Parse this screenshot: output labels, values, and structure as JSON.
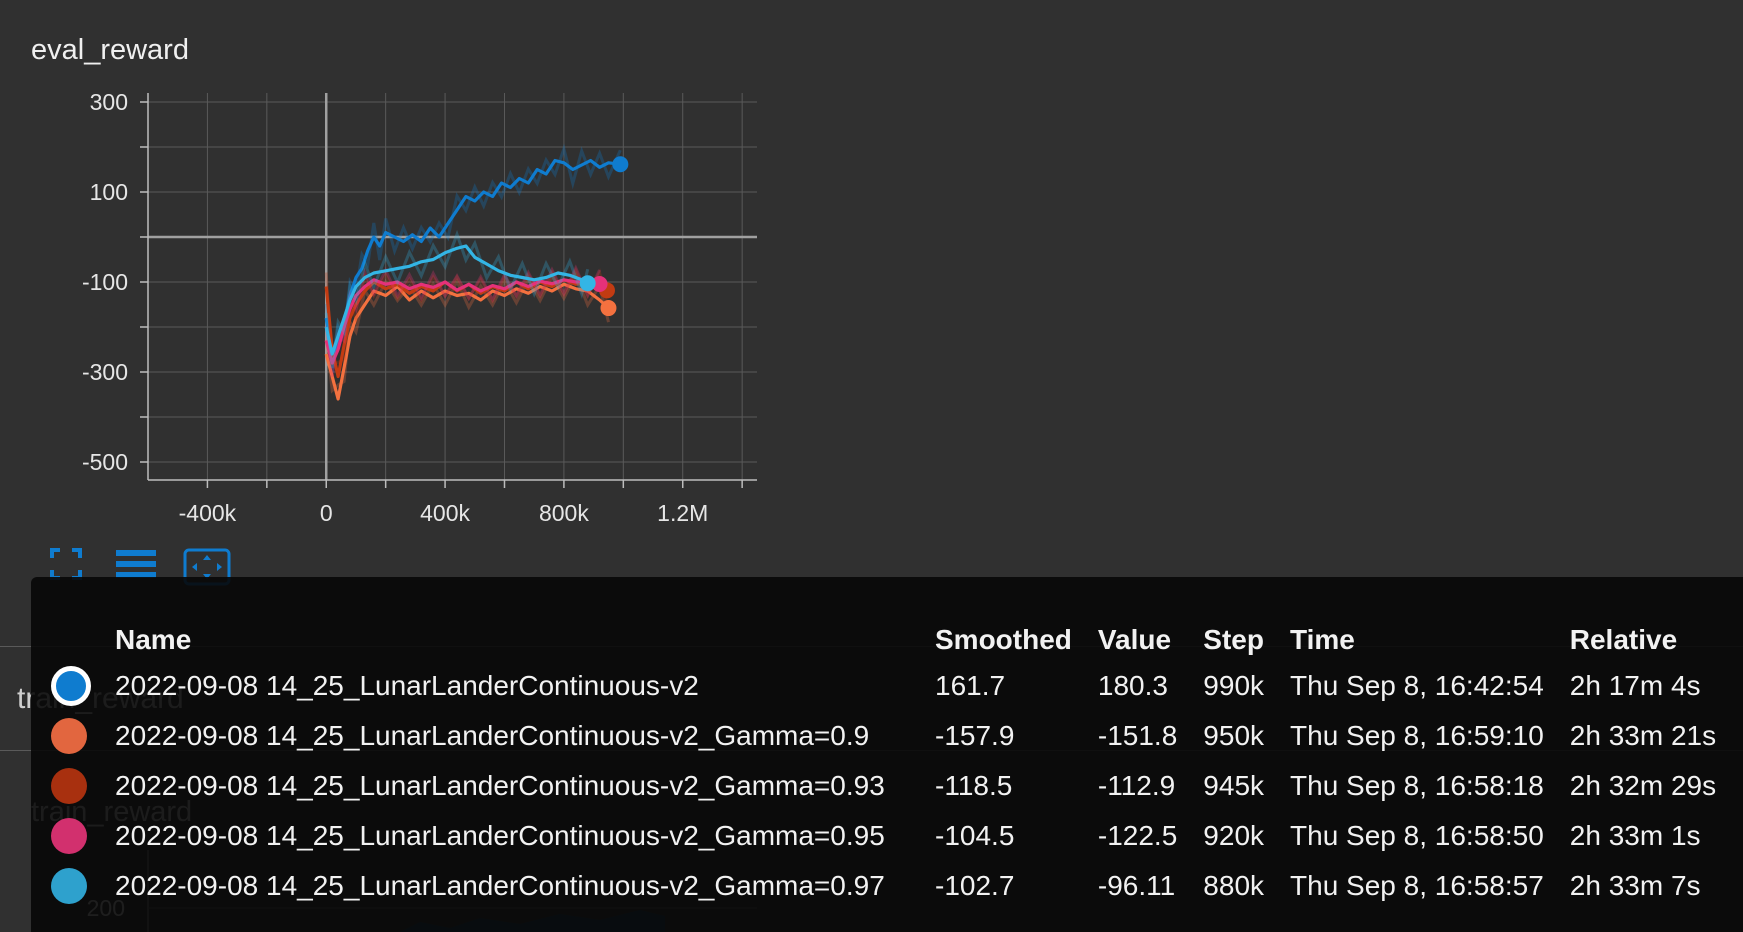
{
  "card": {
    "title": "eval_reward"
  },
  "chart_data": {
    "type": "line",
    "title": "eval_reward",
    "xlabel": "",
    "ylabel": "",
    "xlim": [
      -600000,
      1450000
    ],
    "ylim": [
      -580000,
      320
    ],
    "x_ticks": [
      "-400k",
      "0",
      "400k",
      "800k",
      "1.2M"
    ],
    "x_tick_values": [
      -400000,
      0,
      400000,
      800000,
      1200000
    ],
    "y_ticks": [
      "300",
      "100",
      "-100",
      "-300",
      "-500"
    ],
    "y_tick_values": [
      300,
      100,
      -100,
      -300,
      -500
    ],
    "grid": true,
    "series": [
      {
        "name": "2022-09-08 14_25_LunarLanderContinuous-v2",
        "color": "#0f7ccf",
        "x": [
          0,
          20000,
          40000,
          60000,
          80000,
          100000,
          120000,
          140000,
          160000,
          180000,
          200000,
          230000,
          260000,
          290000,
          320000,
          350000,
          380000,
          410000,
          440000,
          470000,
          500000,
          530000,
          560000,
          590000,
          620000,
          650000,
          680000,
          710000,
          740000,
          770000,
          800000,
          830000,
          860000,
          890000,
          920000,
          950000,
          990000
        ],
        "values": [
          -180,
          -270,
          -230,
          -190,
          -130,
          -90,
          -70,
          -30,
          0,
          -20,
          10,
          0,
          -10,
          5,
          -10,
          20,
          0,
          30,
          60,
          90,
          80,
          100,
          90,
          120,
          110,
          130,
          120,
          150,
          140,
          170,
          165,
          150,
          160,
          170,
          155,
          165,
          161.7
        ],
        "end_marker": 161.7
      },
      {
        "name": "2022-09-08 14_25_LunarLanderContinuous-v2_Gamma=0.9",
        "color": "#f4713f",
        "x": [
          0,
          20000,
          40000,
          60000,
          80000,
          100000,
          130000,
          160000,
          200000,
          240000,
          280000,
          320000,
          360000,
          400000,
          440000,
          480000,
          520000,
          560000,
          600000,
          640000,
          680000,
          720000,
          760000,
          800000,
          840000,
          880000,
          920000,
          950000
        ],
        "values": [
          -260,
          -310,
          -360,
          -290,
          -220,
          -180,
          -150,
          -120,
          -130,
          -110,
          -140,
          -120,
          -135,
          -120,
          -130,
          -125,
          -140,
          -120,
          -130,
          -115,
          -125,
          -110,
          -120,
          -105,
          -115,
          -120,
          -140,
          -157.9
        ],
        "end_marker": -157.9
      },
      {
        "name": "2022-09-08 14_25_LunarLanderContinuous-v2_Gamma=0.93",
        "color": "#c23b12",
        "x": [
          0,
          20000,
          40000,
          60000,
          80000,
          100000,
          130000,
          160000,
          200000,
          240000,
          280000,
          320000,
          360000,
          400000,
          440000,
          480000,
          520000,
          560000,
          600000,
          640000,
          680000,
          720000,
          760000,
          800000,
          840000,
          880000,
          920000,
          945000
        ],
        "values": [
          -110,
          -250,
          -310,
          -240,
          -180,
          -150,
          -120,
          -100,
          -115,
          -105,
          -125,
          -110,
          -120,
          -100,
          -120,
          -105,
          -125,
          -110,
          -120,
          -100,
          -115,
          -100,
          -110,
          -95,
          -105,
          -100,
          -110,
          -118.5
        ],
        "end_marker": -118.5
      },
      {
        "name": "2022-09-08 14_25_LunarLanderContinuous-v2_Gamma=0.95",
        "color": "#e5317a",
        "x": [
          0,
          20000,
          40000,
          60000,
          80000,
          100000,
          130000,
          160000,
          200000,
          240000,
          280000,
          320000,
          360000,
          400000,
          440000,
          480000,
          520000,
          560000,
          600000,
          640000,
          680000,
          720000,
          760000,
          800000,
          840000,
          880000,
          920000
        ],
        "values": [
          -230,
          -280,
          -250,
          -200,
          -160,
          -130,
          -110,
          -95,
          -105,
          -100,
          -115,
          -105,
          -112,
          -100,
          -118,
          -105,
          -120,
          -108,
          -115,
          -100,
          -110,
          -98,
          -104,
          -95,
          -100,
          -98,
          -104.5
        ],
        "end_marker": -104.5
      },
      {
        "name": "2022-09-08 14_25_LunarLanderContinuous-v2_Gamma=0.97",
        "color": "#33b5e5",
        "x": [
          0,
          20000,
          40000,
          60000,
          80000,
          100000,
          130000,
          160000,
          200000,
          240000,
          280000,
          320000,
          360000,
          400000,
          440000,
          470000,
          500000,
          540000,
          580000,
          620000,
          660000,
          700000,
          740000,
          780000,
          820000,
          860000,
          880000
        ],
        "values": [
          -200,
          -260,
          -220,
          -180,
          -140,
          -110,
          -90,
          -80,
          -75,
          -70,
          -65,
          -55,
          -50,
          -35,
          -25,
          -20,
          -45,
          -60,
          -75,
          -85,
          -90,
          -95,
          -90,
          -80,
          -85,
          -95,
          -102.7
        ],
        "end_marker": -102.7
      }
    ]
  },
  "toolbar": {
    "fullscreen_icon": "fullscreen-icon",
    "toggle_log_icon": "toggle-y-log-icon",
    "fit_domain_icon": "fit-domain-icon",
    "accent": "#0f7ccf"
  },
  "background_cards": {
    "title_1": "train_reward",
    "title_2": "train_reward",
    "y_tick": "200"
  },
  "tooltip": {
    "headers": {
      "name": "Name",
      "smoothed": "Smoothed",
      "value": "Value",
      "step": "Step",
      "time": "Time",
      "relative": "Relative"
    },
    "rows": [
      {
        "color": "#0f7ccf",
        "selected": true,
        "name": "2022-09-08 14_25_LunarLanderContinuous-v2",
        "smoothed": "161.7",
        "value": "180.3",
        "step": "990k",
        "time": "Thu Sep 8, 16:42:54",
        "relative": "2h 17m 4s"
      },
      {
        "color": "#e2663f",
        "selected": false,
        "name": "2022-09-08 14_25_LunarLanderContinuous-v2_Gamma=0.9",
        "smoothed": "-157.9",
        "value": "-151.8",
        "step": "950k",
        "time": "Thu Sep 8, 16:59:10",
        "relative": "2h 33m 21s"
      },
      {
        "color": "#a8300f",
        "selected": false,
        "name": "2022-09-08 14_25_LunarLanderContinuous-v2_Gamma=0.93",
        "smoothed": "-118.5",
        "value": "-112.9",
        "step": "945k",
        "time": "Thu Sep 8, 16:58:18",
        "relative": "2h 32m 29s"
      },
      {
        "color": "#d2306e",
        "selected": false,
        "name": "2022-09-08 14_25_LunarLanderContinuous-v2_Gamma=0.95",
        "smoothed": "-104.5",
        "value": "-122.5",
        "step": "920k",
        "time": "Thu Sep 8, 16:58:50",
        "relative": "2h 33m 1s"
      },
      {
        "color": "#2ea1cd",
        "selected": false,
        "name": "2022-09-08 14_25_LunarLanderContinuous-v2_Gamma=0.97",
        "smoothed": "-102.7",
        "value": "-96.11",
        "step": "880k",
        "time": "Thu Sep 8, 16:58:57",
        "relative": "2h 33m 7s"
      }
    ]
  }
}
